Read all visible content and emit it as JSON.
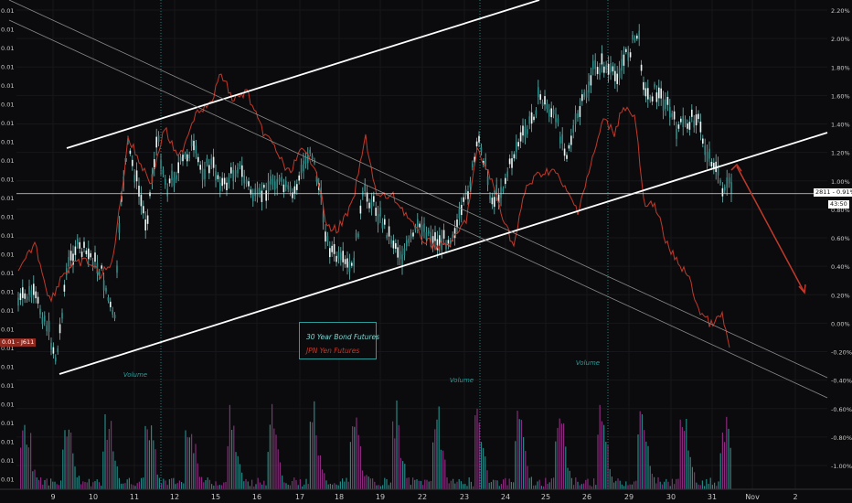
{
  "chart_data": {
    "type": "candlestick+line+bar",
    "series": [
      {
        "name": "30 Year Bond Futures",
        "color": "#7fd6d2"
      },
      {
        "name": "JPN Yen Futures",
        "color": "#c0392b"
      }
    ],
    "x_tick_labels": [
      "9",
      "10",
      "11",
      "12",
      "15",
      "16",
      "17",
      "18",
      "19",
      "22",
      "23",
      "24",
      "25",
      "26",
      "29",
      "30",
      "31",
      "Nov",
      "2"
    ],
    "right_axis": {
      "labels": [
        "2.20%",
        "2.00%",
        "1.80%",
        "1.60%",
        "1.40%",
        "1.20%",
        "1.00%",
        "0.80%",
        "0.60%",
        "0.40%",
        "0.20%",
        "0.00%",
        "-0.20%",
        "-0.40%",
        "-0.60%",
        "-0.80%",
        "-1.00%"
      ],
      "values": [
        2.2,
        2.0,
        1.8,
        1.6,
        1.4,
        1.2,
        1.0,
        0.8,
        0.6,
        0.4,
        0.2,
        0.0,
        -0.2,
        -0.4,
        -0.6,
        -0.8,
        -1.0
      ],
      "range": [
        -1.1,
        2.25
      ]
    },
    "left_axis_label": "0.01",
    "left_axis_count": 26,
    "volume_labels": [
      {
        "text": "Volume",
        "day": "11"
      },
      {
        "text": "Volume",
        "day": "23"
      },
      {
        "text": "Volume",
        "day": "26"
      }
    ],
    "horizontal_level": 0.91,
    "price_tag_right": "2811 - 0.91%",
    "price_tag_right_2": "43:50",
    "price_tag_left": "0.01 - J611",
    "colors": {
      "bond": "#7fd6d2",
      "yen": "#c0392b",
      "trend": "#ffffff",
      "arrow": "#c0392b",
      "volume_a": "#2a9d9a",
      "volume_b": "#a0308f"
    }
  }
}
